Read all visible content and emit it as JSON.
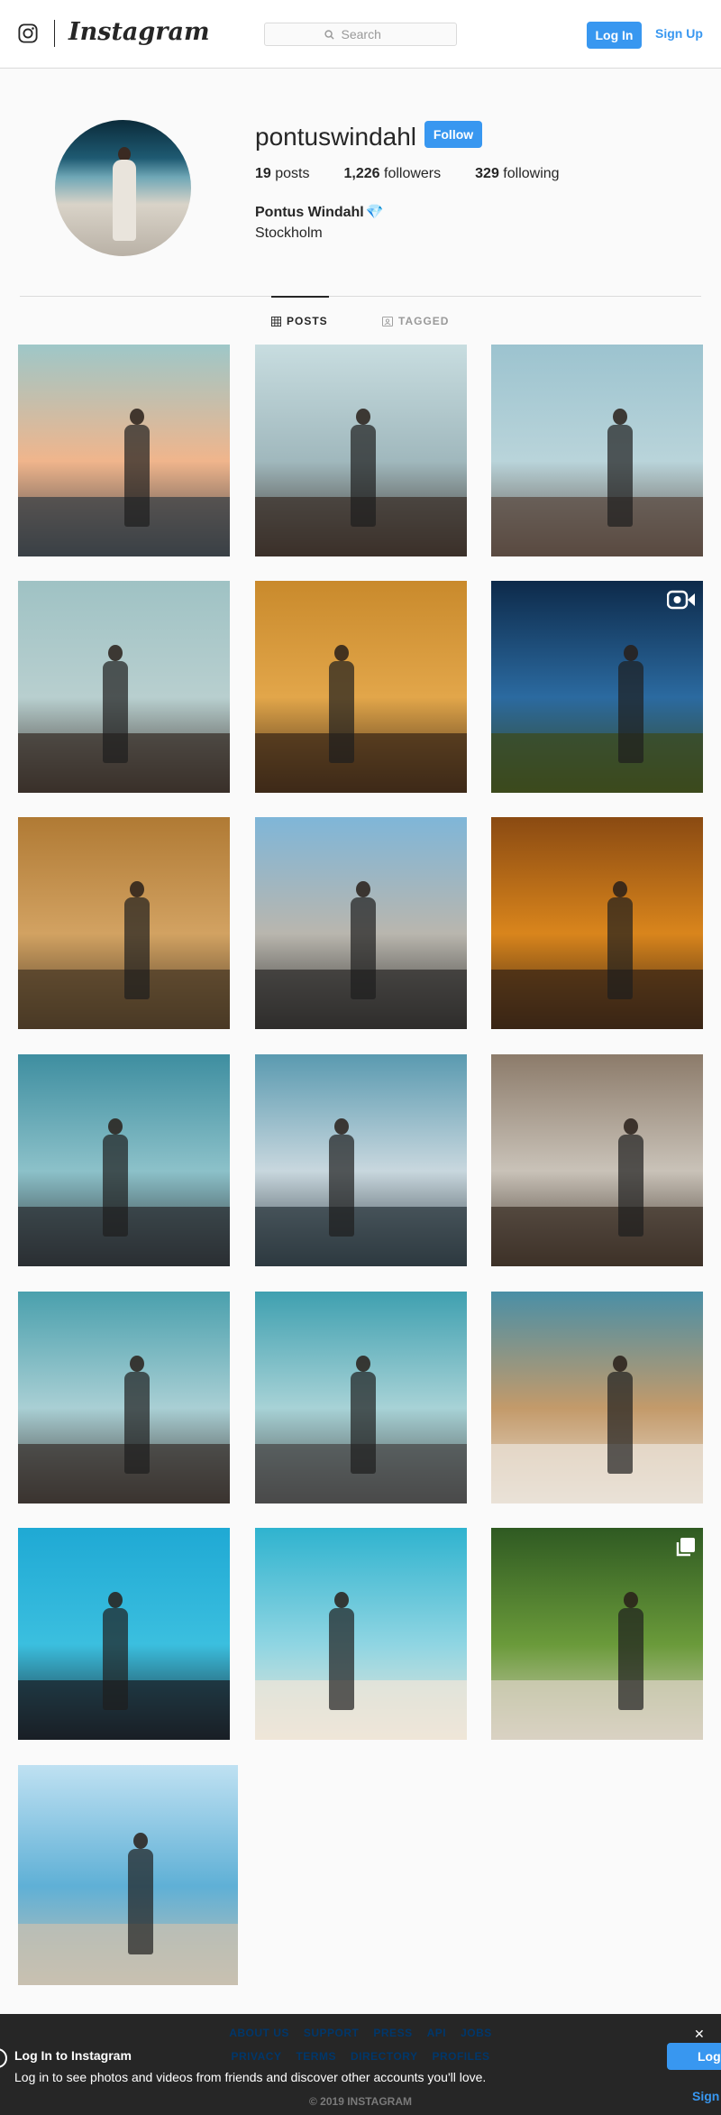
{
  "header": {
    "brand": "Instagram",
    "search_placeholder": "Search",
    "login_label": "Log In",
    "signup_label": "Sign Up"
  },
  "profile": {
    "username": "pontuswindahl",
    "follow_label": "Follow",
    "posts_count": "19",
    "posts_label": "posts",
    "followers_count": "1,226",
    "followers_label": "followers",
    "following_count": "329",
    "following_label": "following",
    "full_name": "Pontus Windahl",
    "bio": "Stockholm"
  },
  "tabs": [
    {
      "label": "POSTS",
      "active": true
    },
    {
      "label": "TAGGED",
      "active": false
    }
  ],
  "posts": [
    {
      "scene": "man-with-white-car",
      "badge": null,
      "colors": [
        "#9ec7c8",
        "#f0b58c",
        "#3a4046"
      ]
    },
    {
      "scene": "man-on-wooden-stairs",
      "badge": null,
      "colors": [
        "#c8dde0",
        "#a0b8bd",
        "#3b3029"
      ]
    },
    {
      "scene": "man-in-snowy-village",
      "badge": null,
      "colors": [
        "#9cc3cf",
        "#b9d4da",
        "#5a4a40"
      ]
    },
    {
      "scene": "man-crouching-on-stairs",
      "badge": null,
      "colors": [
        "#9fc2c4",
        "#b8cfcf",
        "#3a302a"
      ]
    },
    {
      "scene": "man-on-autumn-tracks",
      "badge": null,
      "colors": [
        "#c98a2c",
        "#e2a64a",
        "#3e2a18"
      ]
    },
    {
      "scene": "three-people-in-field",
      "badge": "video-icon",
      "colors": [
        "#0d2a4a",
        "#2b6aa0",
        "#3c4a1c"
      ]
    },
    {
      "scene": "man-walking-autumn-forest",
      "badge": null,
      "colors": [
        "#b07a34",
        "#d2a262",
        "#4a3a26"
      ]
    },
    {
      "scene": "man-sitting-on-railing",
      "badge": null,
      "colors": [
        "#7fb6d8",
        "#b9b6ae",
        "#2f2e2c"
      ]
    },
    {
      "scene": "man-on-orange-tracks",
      "badge": null,
      "colors": [
        "#8a4a12",
        "#d9851c",
        "#3a2616"
      ]
    },
    {
      "scene": "man-on-ledge-sky",
      "badge": null,
      "colors": [
        "#3e8ea0",
        "#8cc1c9",
        "#2b2f33"
      ]
    },
    {
      "scene": "man-in-white-pants",
      "badge": null,
      "colors": [
        "#5a9ab0",
        "#c8d7de",
        "#2e3a40"
      ]
    },
    {
      "scene": "waterfall-rocks",
      "badge": null,
      "colors": [
        "#8c7b6a",
        "#c9c2b8",
        "#3d3228"
      ]
    },
    {
      "scene": "man-on-rooftop",
      "badge": null,
      "colors": [
        "#4aa0ad",
        "#a9cfd4",
        "#3b3430"
      ]
    },
    {
      "scene": "man-walking-bridge",
      "badge": null,
      "colors": [
        "#3fa0b0",
        "#a7d2d6",
        "#4a4a4a"
      ]
    },
    {
      "scene": "face-with-scarf",
      "badge": null,
      "colors": [
        "#4a8fa6",
        "#c39a6a",
        "#e9e1d7"
      ]
    },
    {
      "scene": "man-with-helmet-sea",
      "badge": null,
      "colors": [
        "#1fa9d4",
        "#3bbfdf",
        "#1a1f26"
      ]
    },
    {
      "scene": "beach-aerial-man",
      "badge": null,
      "colors": [
        "#2fb3cf",
        "#8fd5e2",
        "#efe6d8"
      ]
    },
    {
      "scene": "man-in-tropical-garden",
      "badge": "album-icon",
      "colors": [
        "#2f5a22",
        "#6a9a3a",
        "#d9d1c3"
      ]
    },
    {
      "scene": "man-sitting-coast",
      "badge": null,
      "colors": [
        "#bfe1f2",
        "#5fb0d6",
        "#c8c0b0"
      ]
    }
  ],
  "footer": {
    "links_row1": [
      "ABOUT US",
      "SUPPORT",
      "PRESS",
      "API",
      "JOBS"
    ],
    "links_row2": [
      "PRIVACY",
      "TERMS",
      "DIRECTORY",
      "PROFILES"
    ],
    "copyright": "© 2019 INSTAGRAM"
  },
  "banner": {
    "title": "Log In to Instagram",
    "text": "Log in to see photos and videos from friends and discover other accounts you'll love.",
    "login_label": "Log",
    "signup_label": "Sign",
    "close_symbol": "✕"
  }
}
